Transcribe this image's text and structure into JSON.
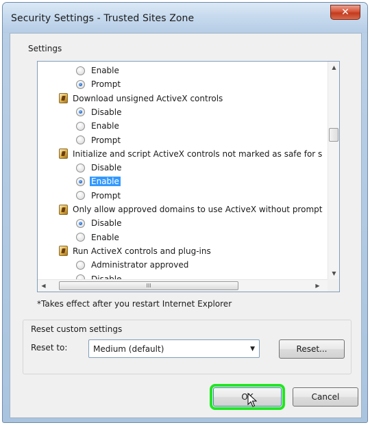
{
  "window": {
    "title": "Security Settings - Trusted Sites Zone",
    "close_label": "✕"
  },
  "settings": {
    "group_label": "Settings",
    "rows": [
      {
        "kind": "option",
        "label": "Enable",
        "checked": false,
        "selected": false
      },
      {
        "kind": "option",
        "label": "Prompt",
        "checked": true,
        "selected": false
      },
      {
        "kind": "header",
        "label": "Download unsigned ActiveX controls"
      },
      {
        "kind": "option",
        "label": "Disable",
        "checked": true,
        "selected": false
      },
      {
        "kind": "option",
        "label": "Enable",
        "checked": false,
        "selected": false
      },
      {
        "kind": "option",
        "label": "Prompt",
        "checked": false,
        "selected": false
      },
      {
        "kind": "header",
        "label": "Initialize and script ActiveX controls not marked as safe for s"
      },
      {
        "kind": "option",
        "label": "Disable",
        "checked": false,
        "selected": false
      },
      {
        "kind": "option",
        "label": "Enable",
        "checked": true,
        "selected": true
      },
      {
        "kind": "option",
        "label": "Prompt",
        "checked": false,
        "selected": false
      },
      {
        "kind": "header",
        "label": "Only allow approved domains to use ActiveX without prompt"
      },
      {
        "kind": "option",
        "label": "Disable",
        "checked": true,
        "selected": false
      },
      {
        "kind": "option",
        "label": "Enable",
        "checked": false,
        "selected": false
      },
      {
        "kind": "header",
        "label": "Run ActiveX controls and plug-ins"
      },
      {
        "kind": "option",
        "label": "Administrator approved",
        "checked": false,
        "selected": false
      },
      {
        "kind": "option",
        "label": "Disable",
        "checked": false,
        "selected": false
      }
    ],
    "hscroll_grip": "III"
  },
  "note": "*Takes effect after you restart Internet Explorer",
  "reset": {
    "group_label": "Reset custom settings",
    "reset_to_label": "Reset to:",
    "selected_level": "Medium (default)",
    "reset_button": "Reset..."
  },
  "footer": {
    "ok_label": "OK",
    "cancel_label": "Cancel"
  },
  "colors": {
    "highlight": "#22e622",
    "selection": "#3399ff"
  }
}
